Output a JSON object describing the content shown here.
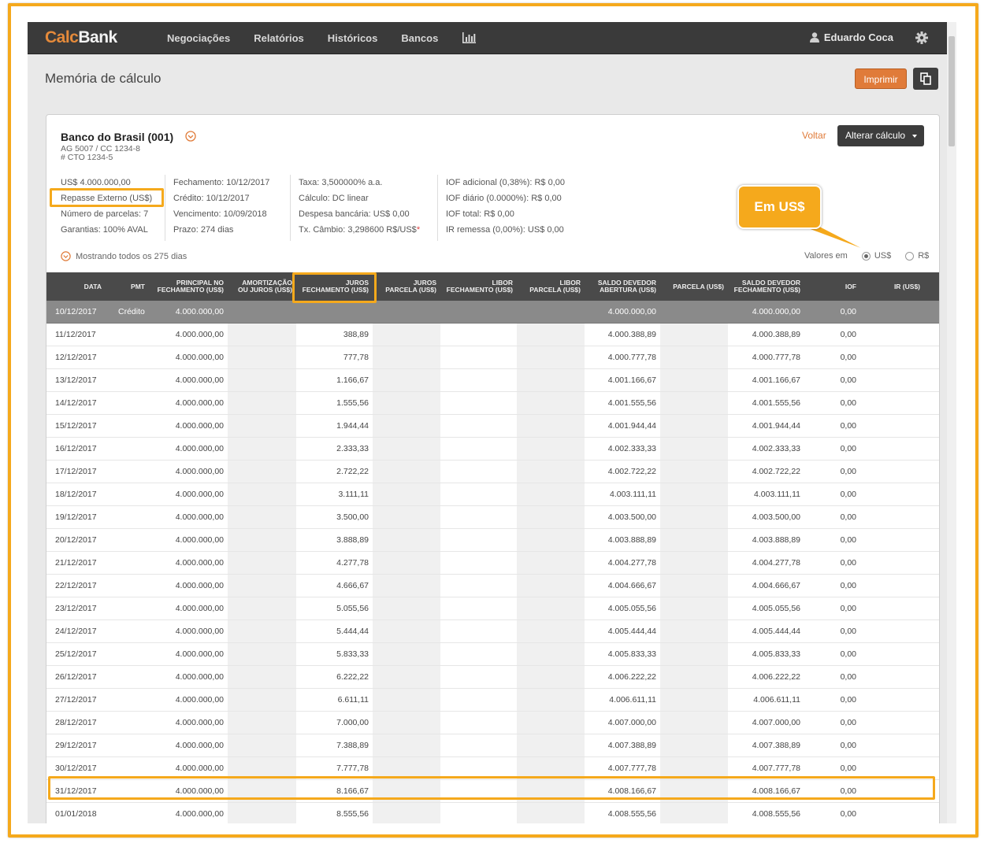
{
  "brand": {
    "part1": "Calc",
    "part2": "Bank"
  },
  "nav": {
    "items": [
      "Negociações",
      "Relatórios",
      "Históricos",
      "Bancos"
    ]
  },
  "user": {
    "name": "Eduardo Coca"
  },
  "page": {
    "title": "Memória de cálculo",
    "print_label": "Imprimir"
  },
  "bank": {
    "name": "Banco do Brasil (001)",
    "line1": "AG 5007 / CC 1234-8",
    "line2": "# CTO 1234-5",
    "back_label": "Voltar",
    "alter_label": "Alterar cálculo"
  },
  "info": {
    "col1": [
      "US$ 4.000.000,00",
      "Repasse Externo (US$)",
      "Número de parcelas: 7",
      "Garantias: 100% AVAL"
    ],
    "col2": [
      "Fechamento: 10/12/2017",
      "Crédito: 10/12/2017",
      "Vencimento: 10/09/2018",
      "Prazo: 274 dias"
    ],
    "col3": [
      "Taxa: 3,500000% a.a.",
      "Cálculo: DC linear",
      "Despesa bancária: US$ 0,00",
      "Tx. Câmbio: 3,298600 R$/US$"
    ],
    "col4": [
      "IOF adicional (0,38%): R$ 0,00",
      "IOF diário (0.0000%): R$ 0,00",
      "IOF total: R$ 0,00",
      "IR remessa (0,00%): US$ 0,00"
    ],
    "required_mark": "*"
  },
  "filters": {
    "showing": "Mostrando todos os 275 dias",
    "values_in": "Valores em",
    "opt_usd": "US$",
    "opt_brl": "R$",
    "selected": "US$"
  },
  "annotation": {
    "callout": "Em US$"
  },
  "table": {
    "headers": [
      [
        "DATA"
      ],
      [
        "PMT"
      ],
      [
        "PRINCIPAL NO",
        "FECHAMENTO (US$)"
      ],
      [
        "AMORTIZAÇÃO",
        "OU JUROS (US$)"
      ],
      [
        "JUROS",
        "FECHAMENTO (US$)"
      ],
      [
        "JUROS",
        "PARCELA (US$)"
      ],
      [
        "LIBOR",
        "FECHAMENTO (US$)"
      ],
      [
        "LIBOR",
        "PARCELA (US$)"
      ],
      [
        "SALDO DEVEDOR",
        "ABERTURA (US$)"
      ],
      [
        "PARCELA (US$)"
      ],
      [
        "SALDO DEVEDOR",
        "FECHAMENTO (US$)"
      ],
      [
        "IOF"
      ],
      [
        "IR (US$)"
      ]
    ],
    "rows": [
      [
        "10/12/2017",
        "Crédito",
        "4.000.000,00",
        "",
        "",
        "",
        "",
        "",
        "4.000.000,00",
        "",
        "4.000.000,00",
        "0,00",
        ""
      ],
      [
        "11/12/2017",
        "",
        "4.000.000,00",
        "",
        "388,89",
        "",
        "",
        "",
        "4.000.388,89",
        "",
        "4.000.388,89",
        "0,00",
        ""
      ],
      [
        "12/12/2017",
        "",
        "4.000.000,00",
        "",
        "777,78",
        "",
        "",
        "",
        "4.000.777,78",
        "",
        "4.000.777,78",
        "0,00",
        ""
      ],
      [
        "13/12/2017",
        "",
        "4.000.000,00",
        "",
        "1.166,67",
        "",
        "",
        "",
        "4.001.166,67",
        "",
        "4.001.166,67",
        "0,00",
        ""
      ],
      [
        "14/12/2017",
        "",
        "4.000.000,00",
        "",
        "1.555,56",
        "",
        "",
        "",
        "4.001.555,56",
        "",
        "4.001.555,56",
        "0,00",
        ""
      ],
      [
        "15/12/2017",
        "",
        "4.000.000,00",
        "",
        "1.944,44",
        "",
        "",
        "",
        "4.001.944,44",
        "",
        "4.001.944,44",
        "0,00",
        ""
      ],
      [
        "16/12/2017",
        "",
        "4.000.000,00",
        "",
        "2.333,33",
        "",
        "",
        "",
        "4.002.333,33",
        "",
        "4.002.333,33",
        "0,00",
        ""
      ],
      [
        "17/12/2017",
        "",
        "4.000.000,00",
        "",
        "2.722,22",
        "",
        "",
        "",
        "4.002.722,22",
        "",
        "4.002.722,22",
        "0,00",
        ""
      ],
      [
        "18/12/2017",
        "",
        "4.000.000,00",
        "",
        "3.111,11",
        "",
        "",
        "",
        "4.003.111,11",
        "",
        "4.003.111,11",
        "0,00",
        ""
      ],
      [
        "19/12/2017",
        "",
        "4.000.000,00",
        "",
        "3.500,00",
        "",
        "",
        "",
        "4.003.500,00",
        "",
        "4.003.500,00",
        "0,00",
        ""
      ],
      [
        "20/12/2017",
        "",
        "4.000.000,00",
        "",
        "3.888,89",
        "",
        "",
        "",
        "4.003.888,89",
        "",
        "4.003.888,89",
        "0,00",
        ""
      ],
      [
        "21/12/2017",
        "",
        "4.000.000,00",
        "",
        "4.277,78",
        "",
        "",
        "",
        "4.004.277,78",
        "",
        "4.004.277,78",
        "0,00",
        ""
      ],
      [
        "22/12/2017",
        "",
        "4.000.000,00",
        "",
        "4.666,67",
        "",
        "",
        "",
        "4.004.666,67",
        "",
        "4.004.666,67",
        "0,00",
        ""
      ],
      [
        "23/12/2017",
        "",
        "4.000.000,00",
        "",
        "5.055,56",
        "",
        "",
        "",
        "4.005.055,56",
        "",
        "4.005.055,56",
        "0,00",
        ""
      ],
      [
        "24/12/2017",
        "",
        "4.000.000,00",
        "",
        "5.444,44",
        "",
        "",
        "",
        "4.005.444,44",
        "",
        "4.005.444,44",
        "0,00",
        ""
      ],
      [
        "25/12/2017",
        "",
        "4.000.000,00",
        "",
        "5.833,33",
        "",
        "",
        "",
        "4.005.833,33",
        "",
        "4.005.833,33",
        "0,00",
        ""
      ],
      [
        "26/12/2017",
        "",
        "4.000.000,00",
        "",
        "6.222,22",
        "",
        "",
        "",
        "4.006.222,22",
        "",
        "4.006.222,22",
        "0,00",
        ""
      ],
      [
        "27/12/2017",
        "",
        "4.000.000,00",
        "",
        "6.611,11",
        "",
        "",
        "",
        "4.006.611,11",
        "",
        "4.006.611,11",
        "0,00",
        ""
      ],
      [
        "28/12/2017",
        "",
        "4.000.000,00",
        "",
        "7.000,00",
        "",
        "",
        "",
        "4.007.000,00",
        "",
        "4.007.000,00",
        "0,00",
        ""
      ],
      [
        "29/12/2017",
        "",
        "4.000.000,00",
        "",
        "7.388,89",
        "",
        "",
        "",
        "4.007.388,89",
        "",
        "4.007.388,89",
        "0,00",
        ""
      ],
      [
        "30/12/2017",
        "",
        "4.000.000,00",
        "",
        "7.777,78",
        "",
        "",
        "",
        "4.007.777,78",
        "",
        "4.007.777,78",
        "0,00",
        ""
      ],
      [
        "31/12/2017",
        "",
        "4.000.000,00",
        "",
        "8.166,67",
        "",
        "",
        "",
        "4.008.166,67",
        "",
        "4.008.166,67",
        "0,00",
        ""
      ],
      [
        "01/01/2018",
        "",
        "4.000.000,00",
        "",
        "8.555,56",
        "",
        "",
        "",
        "4.008.555,56",
        "",
        "4.008.555,56",
        "0,00",
        ""
      ]
    ]
  },
  "colors": {
    "accent": "#e07b39",
    "highlight": "#f5a91c",
    "dark": "#3a3a3a"
  }
}
